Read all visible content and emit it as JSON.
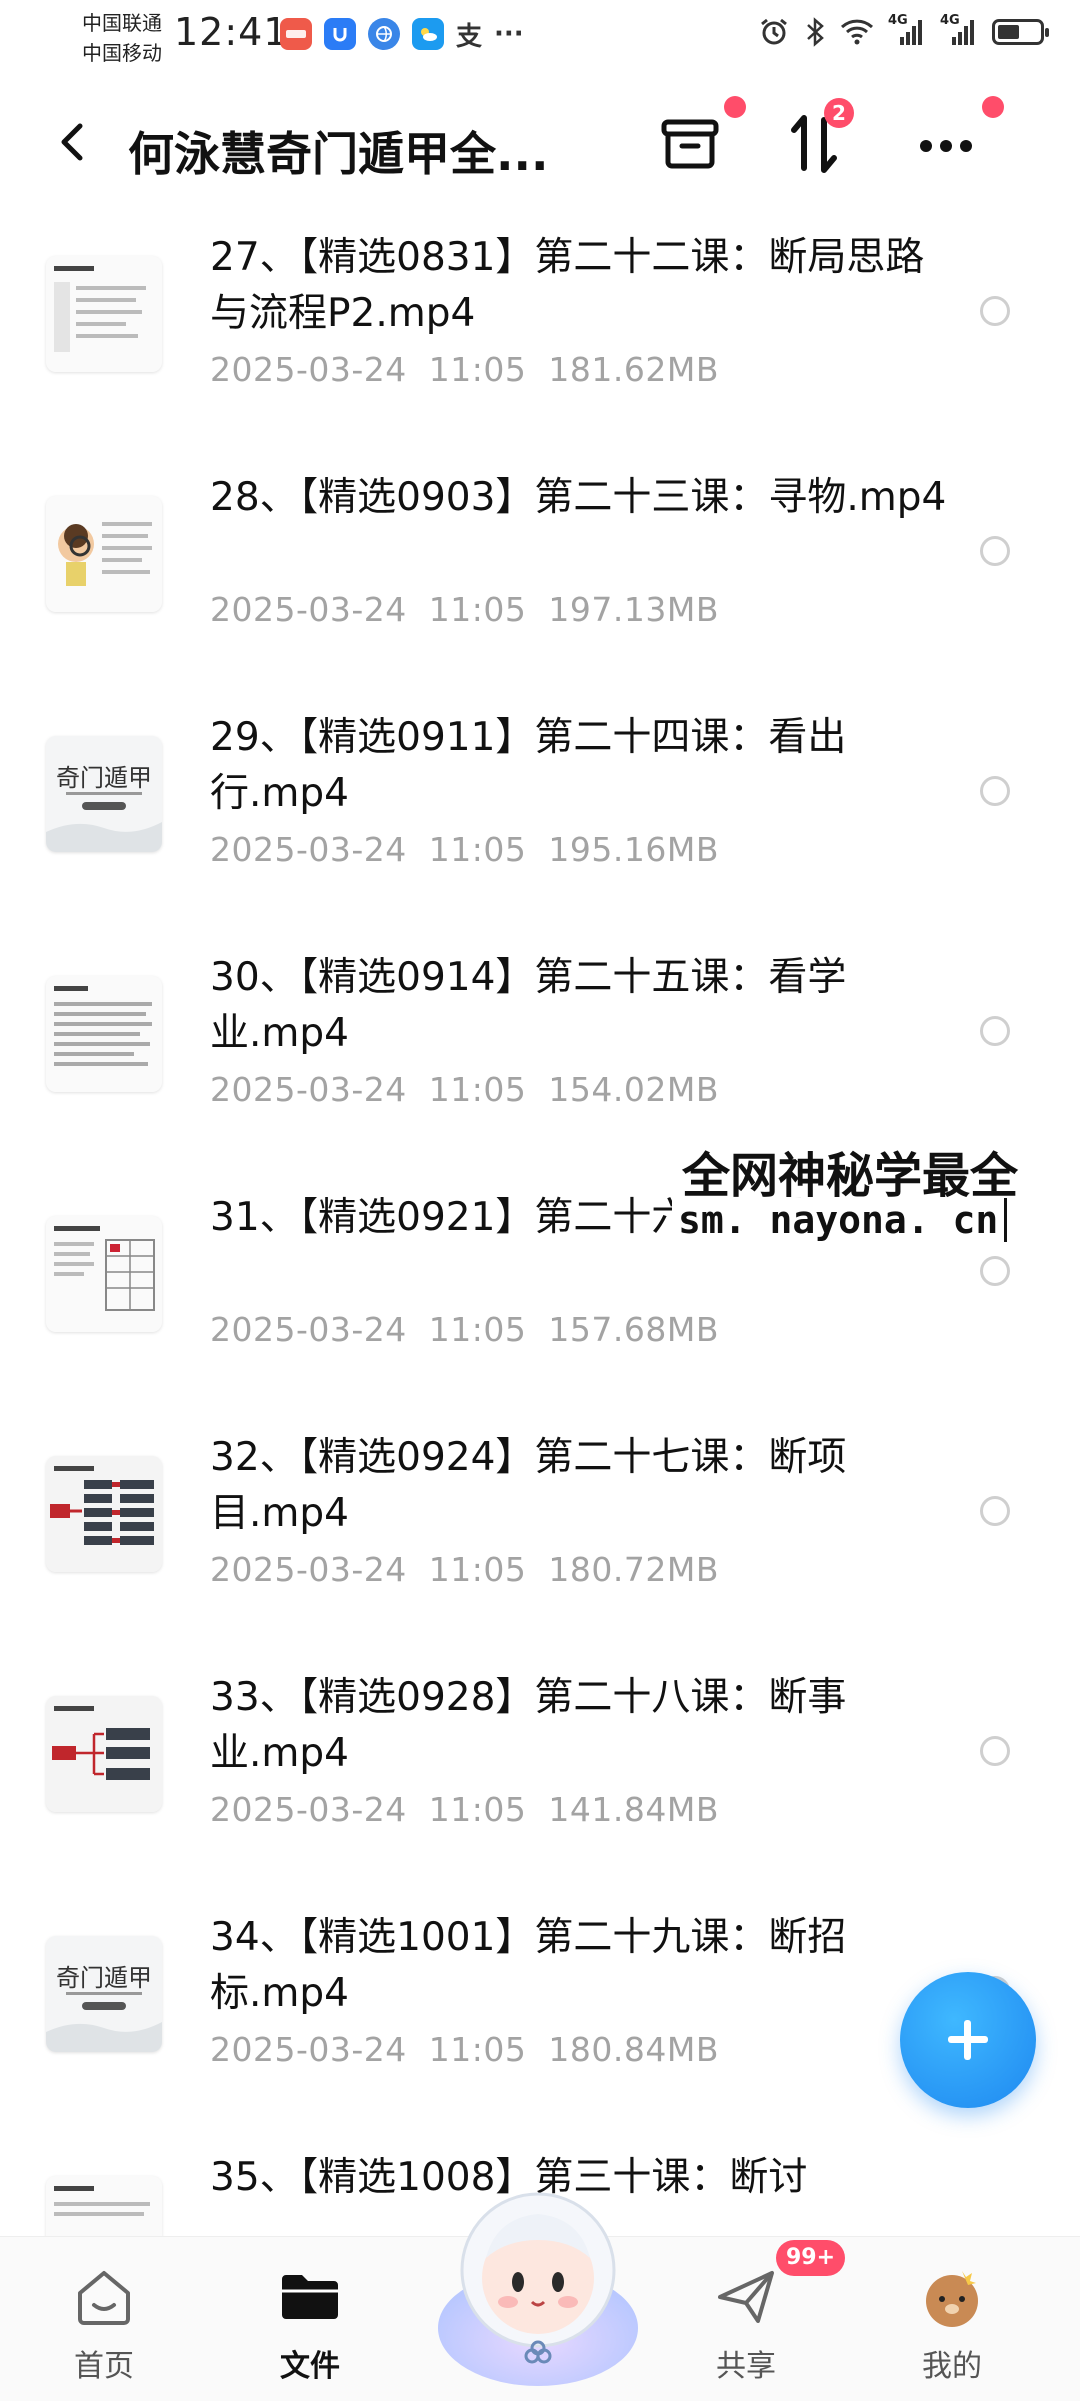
{
  "status_bar": {
    "carrier_1": "中国联通",
    "carrier_2": "中国移动",
    "time": "12:41",
    "notification_icons": [
      "huawei-app-icon",
      "u-app-icon",
      "browser-icon",
      "weather-icon",
      "alipay-icon",
      "more-dots"
    ],
    "alipay_glyph": "支",
    "more_glyph": "···",
    "network_1": "4G",
    "network_2": "4G"
  },
  "header": {
    "title": "何泳慧奇门遁甲全...",
    "sort_badge": "2"
  },
  "files": [
    {
      "name": "27、【精选0831】第二十二课：断局思路与流程P2.mp4",
      "date": "2025-03-24",
      "time": "11:05",
      "size": "181.62MB",
      "thumb": "slides-text"
    },
    {
      "name": "28、【精选0903】第二十三课：寻物.mp4",
      "date": "2025-03-24",
      "time": "11:05",
      "size": "197.13MB",
      "thumb": "cartoon-magnifier"
    },
    {
      "name": "29、【精选0911】第二十四课：看出行.mp4",
      "date": "2025-03-24",
      "time": "11:05",
      "size": "195.16MB",
      "thumb": "qimen-cover",
      "thumb_text": "奇门遁甲"
    },
    {
      "name": "30、【精选0914】第二十五课：看学业.mp4",
      "date": "2025-03-24",
      "time": "11:05",
      "size": "154.02MB",
      "thumb": "slides-text"
    },
    {
      "name": "31、【精选0921】第二十六课：看运.mp4",
      "date": "2025-03-24",
      "time": "11:05",
      "size": "157.68MB",
      "thumb": "slides-table"
    },
    {
      "name": "32、【精选0924】第二十七课：断项目.mp4",
      "date": "2025-03-24",
      "time": "11:05",
      "size": "180.72MB",
      "thumb": "slides-red-grid"
    },
    {
      "name": "33、【精选0928】第二十八课：断事业.mp4",
      "date": "2025-03-24",
      "time": "11:05",
      "size": "141.84MB",
      "thumb": "slides-red-boxes"
    },
    {
      "name": "34、【精选1001】第二十九课：断招标.mp4",
      "date": "2025-03-24",
      "time": "11:05",
      "size": "180.84MB",
      "thumb": "qimen-cover",
      "thumb_text": "奇门遁甲"
    },
    {
      "name": "35、【精选1008】第三十课：断讨",
      "date": "",
      "time": "",
      "size": "",
      "thumb": "slides-text"
    }
  ],
  "watermark": {
    "line1": "全网神秘学最全",
    "line2": "sm. nayona. cn"
  },
  "bottom_nav": {
    "tabs": [
      {
        "label": "首页",
        "icon": "home-icon"
      },
      {
        "label": "文件",
        "icon": "folder-icon"
      },
      {
        "label": "",
        "icon": "mascot-icon"
      },
      {
        "label": "共享",
        "icon": "send-icon"
      },
      {
        "label": "我的",
        "icon": "profile-avatar-icon"
      }
    ],
    "share_badge": "99+"
  },
  "colors": {
    "accent_blue": "#1e88f0",
    "badge_red": "#ff4d6a",
    "meta_gray": "#a3a3a3"
  }
}
